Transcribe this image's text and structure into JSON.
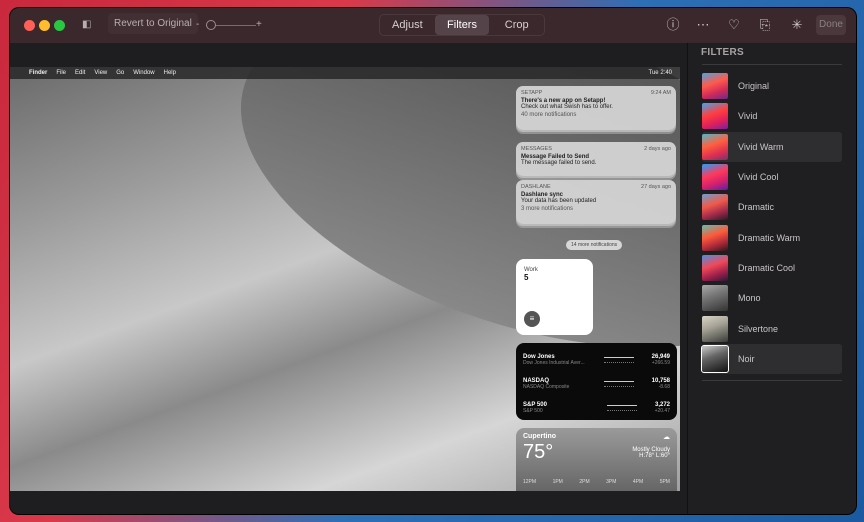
{
  "toolbar": {
    "revert_label": "Revert to Original",
    "zoom_minus": "-",
    "zoom_plus": "+",
    "tabs": [
      "Adjust",
      "Filters",
      "Crop"
    ],
    "active_tab": "Filters",
    "done_label": "Done",
    "icons": [
      "info-icon",
      "more-icon",
      "heart-icon",
      "rotate-icon",
      "auto-enhance-icon"
    ]
  },
  "photo": {
    "menubar": {
      "items": [
        "Finder",
        "File",
        "Edit",
        "View",
        "Go",
        "Window",
        "Help"
      ],
      "clock": "Tue 2:40"
    },
    "notifications": [
      {
        "app": "SETAPP",
        "time": "9:24 AM",
        "title": "There's a new app on Setapp!",
        "body": "Check out what Swish has to offer.",
        "more": "40 more notifications"
      },
      {
        "app": "MESSAGES",
        "time": "2 days ago",
        "title": "Message Failed to Send",
        "body": "The message failed to send.",
        "more": ""
      },
      {
        "app": "DASHLANE",
        "time": "27 days ago",
        "title": "Dashlane sync",
        "body": "Your data has been updated",
        "more": "3 more notifications"
      }
    ],
    "more_pill": "14 more notifications",
    "work": {
      "label": "Work",
      "count": "5"
    },
    "stocks": [
      {
        "name": "Dow Jones",
        "sub": "Dow Jones Industrial Aver...",
        "value": "26,949",
        "change": "+266.59"
      },
      {
        "name": "NASDAQ",
        "sub": "NASDAQ Composite",
        "value": "10,758",
        "change": "-8.68"
      },
      {
        "name": "S&P 500",
        "sub": "S&P 500",
        "value": "3,272",
        "change": "+20.47"
      }
    ],
    "weather": {
      "city": "Cupertino",
      "temp": "75°",
      "cond": "Mostly Cloudy",
      "range": "H:78° L:60°",
      "hours": [
        "12PM",
        "1PM",
        "2PM",
        "3PM",
        "4PM",
        "5PM"
      ]
    }
  },
  "sidebar": {
    "title": "FILTERS",
    "filters": [
      "Original",
      "Vivid",
      "Vivid Warm",
      "Vivid Cool",
      "Dramatic",
      "Dramatic Warm",
      "Dramatic Cool",
      "Mono",
      "Silvertone",
      "Noir"
    ],
    "hovered": "Vivid Warm",
    "selected": "Noir"
  },
  "colors": {
    "titlebar": "#3a282c",
    "sidebar": "#1f1e20",
    "close": "#ff5f57",
    "minimize": "#febc2e",
    "zoom": "#28c840"
  }
}
